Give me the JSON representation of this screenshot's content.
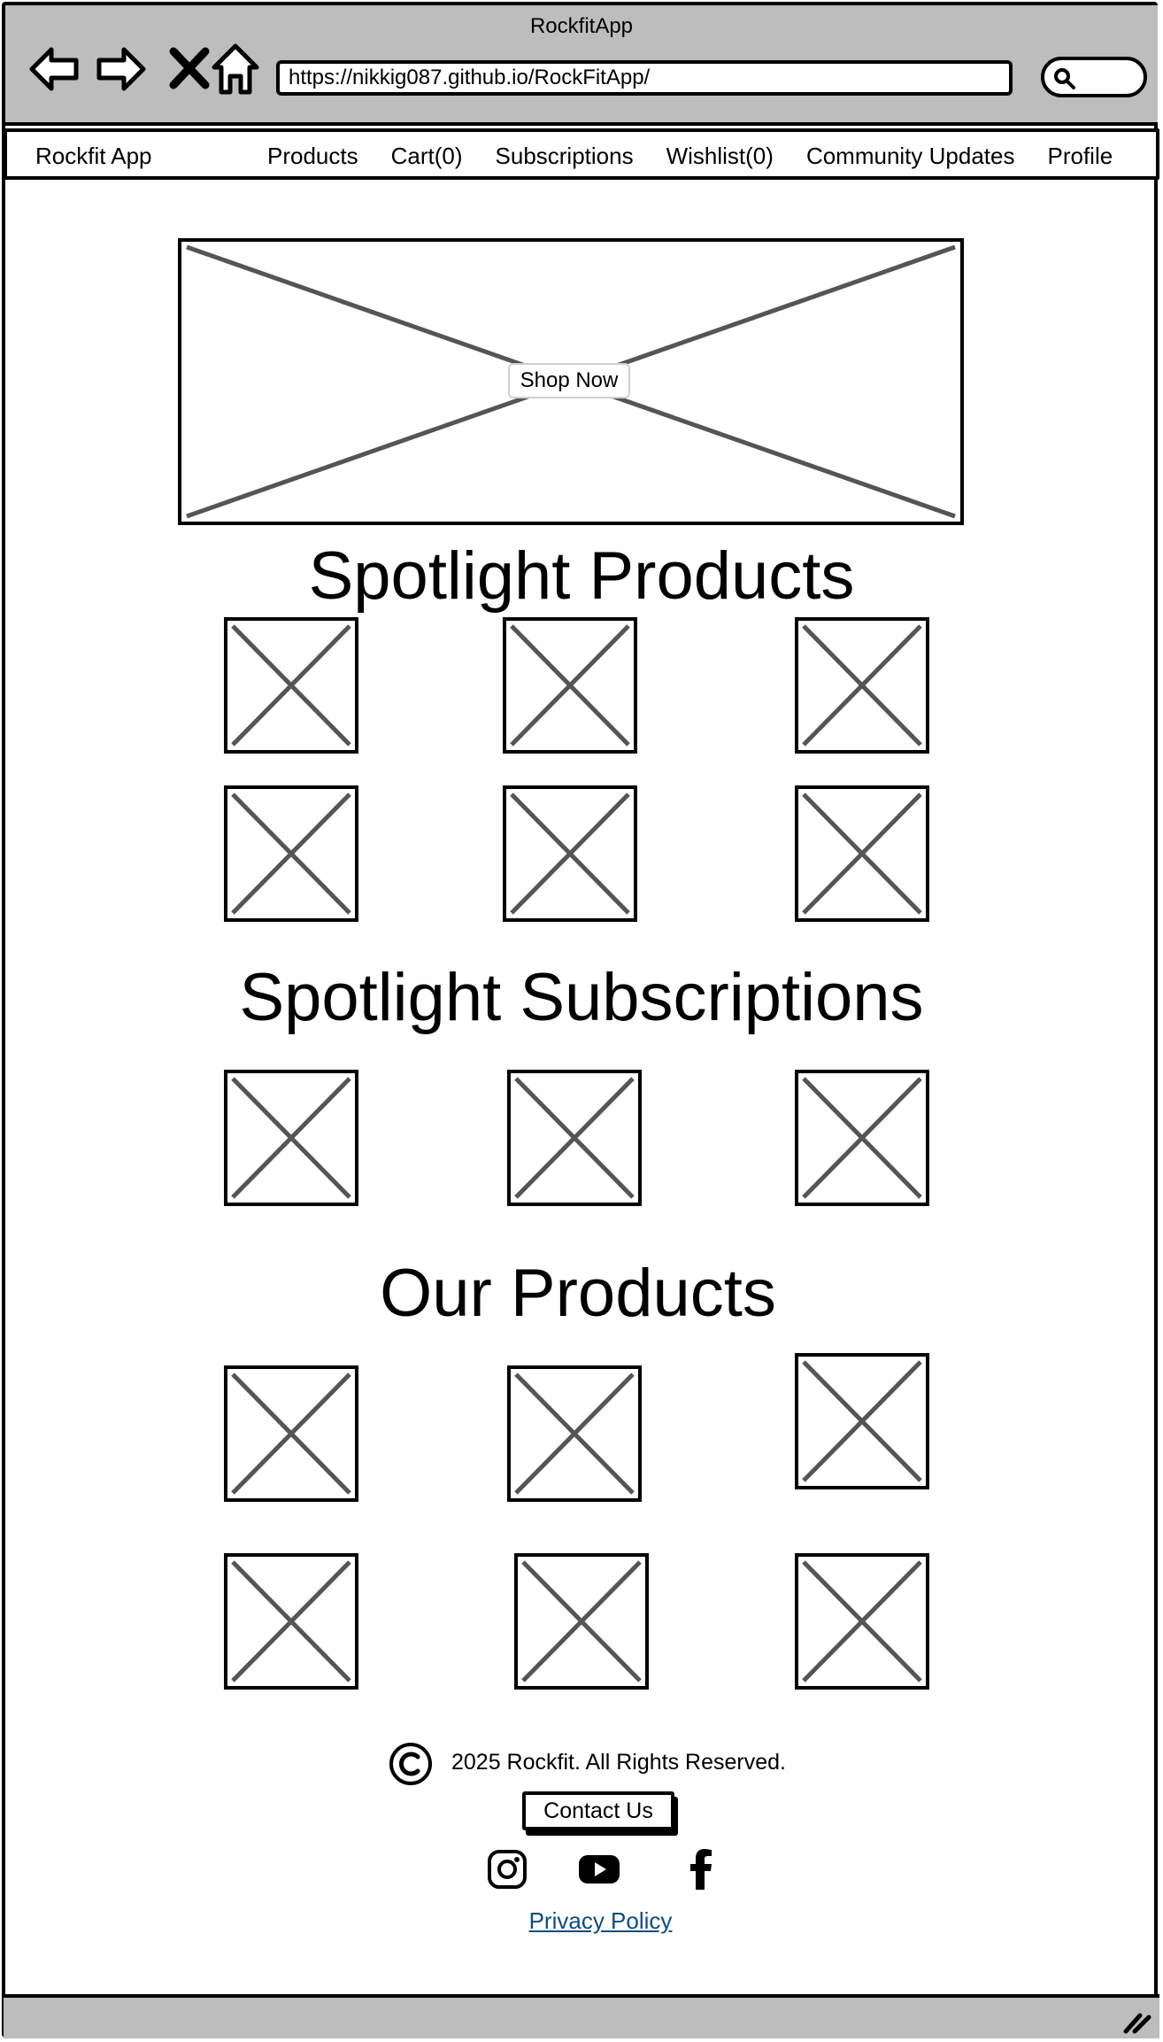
{
  "window": {
    "title": "RockfitApp"
  },
  "browser": {
    "url": "https://nikkig087.github.io/RockFitApp/",
    "icons": [
      "back-arrow-icon",
      "forward-arrow-icon",
      "close-x-icon",
      "home-icon",
      "search-icon"
    ]
  },
  "nav": {
    "brand": "Rockfit App",
    "links": [
      "Products",
      "Cart(0)",
      "Subscriptions",
      "Wishlist(0)",
      "Community Updates",
      "Profile"
    ]
  },
  "hero": {
    "button_label": "Shop Now"
  },
  "sections": {
    "spotlight_products": "Spotlight Products",
    "spotlight_subscriptions": "Spotlight Subscriptions",
    "our_products": "Our Products"
  },
  "footer": {
    "copyright": "2025 Rockfit. All Rights Reserved.",
    "contact_label": "Contact Us",
    "social_icons": [
      "instagram-icon",
      "youtube-icon",
      "facebook-icon"
    ],
    "privacy_label": "Privacy Policy",
    "link_color": "#0f4c81"
  },
  "colors": {
    "chrome": "#bdbdbd",
    "placeholder_stroke": "#555555"
  }
}
